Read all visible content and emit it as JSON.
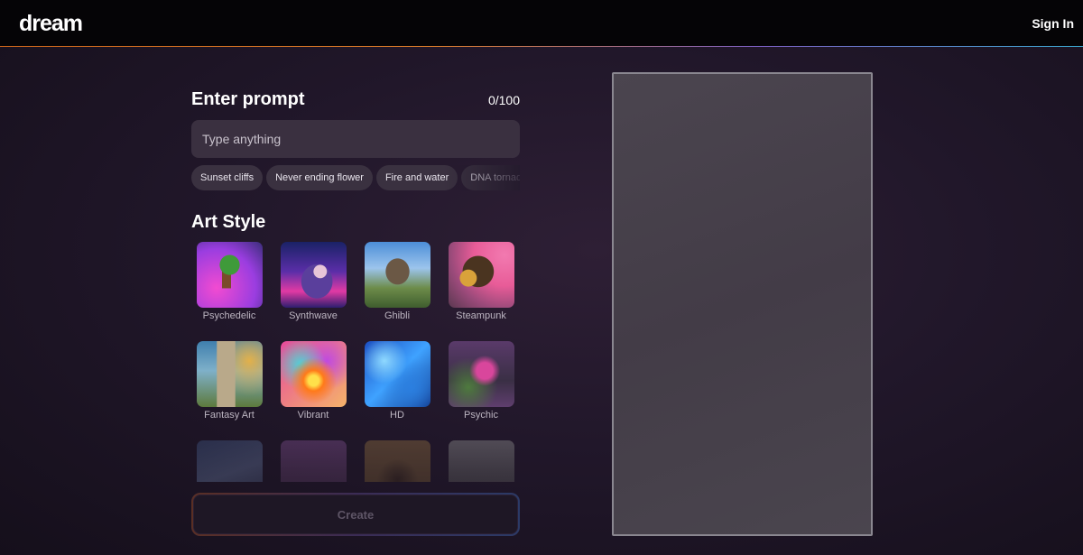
{
  "header": {
    "logo": "dream",
    "signin_label": "Sign In"
  },
  "prompt": {
    "title": "Enter prompt",
    "counter": "0/100",
    "placeholder": "Type anything",
    "suggestions": [
      "Sunset cliffs",
      "Never ending flower",
      "Fire and water",
      "DNA tornado"
    ]
  },
  "art_style": {
    "title": "Art Style",
    "styles": [
      {
        "label": "Psychedelic",
        "icon": "psychedelic-thumbnail"
      },
      {
        "label": "Synthwave",
        "icon": "synthwave-thumbnail"
      },
      {
        "label": "Ghibli",
        "icon": "ghibli-thumbnail"
      },
      {
        "label": "Steampunk",
        "icon": "steampunk-thumbnail"
      },
      {
        "label": "Fantasy Art",
        "icon": "fantasy-art-thumbnail"
      },
      {
        "label": "Vibrant",
        "icon": "vibrant-thumbnail"
      },
      {
        "label": "HD",
        "icon": "hd-thumbnail"
      },
      {
        "label": "Psychic",
        "icon": "psychic-thumbnail"
      },
      {
        "label": "",
        "icon": "style-thumbnail"
      },
      {
        "label": "",
        "icon": "style-thumbnail"
      },
      {
        "label": "",
        "icon": "style-thumbnail"
      },
      {
        "label": "",
        "icon": "style-thumbnail"
      }
    ]
  },
  "create_label": "Create",
  "colors": {
    "accent_orange": "#c8631b",
    "accent_blue": "#3aa3c9",
    "panel": "#3a3040"
  }
}
